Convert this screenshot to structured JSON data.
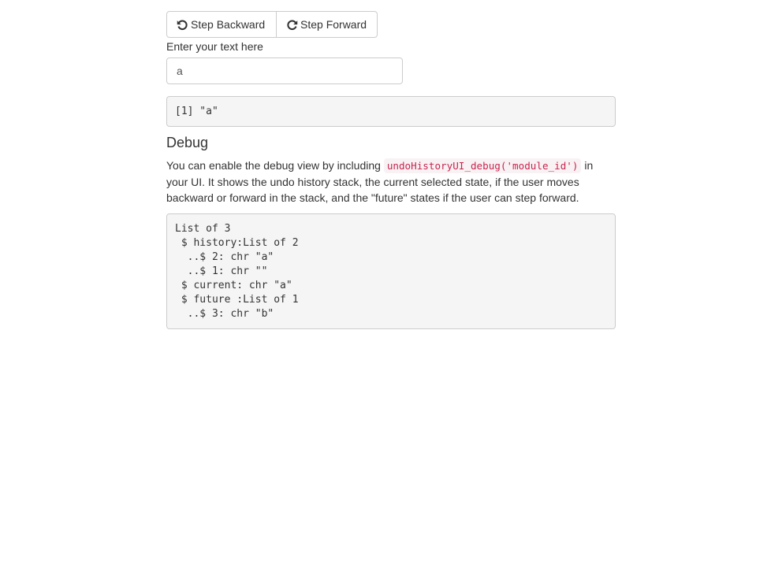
{
  "toolbar": {
    "backward_label": "Step Backward",
    "forward_label": "Step Forward",
    "backward_icon": "undo-icon",
    "forward_icon": "redo-icon"
  },
  "input": {
    "label": "Enter your text here",
    "value": "a"
  },
  "output": {
    "text": "[1] \"a\""
  },
  "debug": {
    "heading": "Debug",
    "description_before": "You can enable the debug view by including ",
    "code": "undoHistoryUI_debug('module_id')",
    "description_after": " in your UI. It shows the undo history stack, the current selected state, if the user moves backward or forward in the stack, and the \"future\" states if the user can step forward.",
    "structure": "List of 3\n $ history:List of 2\n  ..$ 2: chr \"a\"\n  ..$ 1: chr \"\"\n $ current: chr \"a\"\n $ future :List of 1\n  ..$ 3: chr \"b\""
  },
  "colors": {
    "code_text": "#c7254e",
    "code_bg": "#f9f2f4",
    "pre_bg": "#f5f5f5",
    "border": "#cccccc"
  }
}
